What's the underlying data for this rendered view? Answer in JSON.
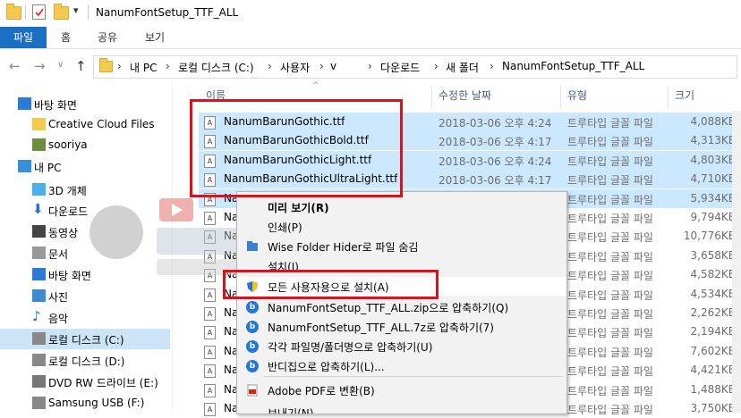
{
  "window": {
    "title": "NanumFontSetup_TTF_ALL"
  },
  "ribbon": {
    "tabs": [
      "파일",
      "홈",
      "공유",
      "보기"
    ]
  },
  "address": {
    "crumbs": [
      "내 PC",
      "로컬 디스크 (C:)",
      "사용자",
      "v",
      "다운로드",
      "새 폴더",
      "NanumFontSetup_TTF_ALL"
    ]
  },
  "nav": {
    "items": [
      {
        "label": "바탕 화면",
        "icon": "desktop-icon"
      },
      {
        "label": "Creative Cloud Files",
        "icon": "creative-cloud-folder-icon"
      },
      {
        "label": "sooriya",
        "icon": "user-icon"
      },
      {
        "label": "내 PC",
        "icon": "pc-icon"
      },
      {
        "label": "3D 개체",
        "icon": "3d-objects-icon"
      },
      {
        "label": "다운로드",
        "icon": "download-icon"
      },
      {
        "label": "동영상",
        "icon": "video-icon"
      },
      {
        "label": "문서",
        "icon": "document-icon"
      },
      {
        "label": "바탕 화면",
        "icon": "desktop-icon"
      },
      {
        "label": "사진",
        "icon": "picture-icon"
      },
      {
        "label": "음악",
        "icon": "music-icon"
      },
      {
        "label": "로컬 디스크 (C:)",
        "icon": "drive-icon"
      },
      {
        "label": "로컬 디스크 (D:)",
        "icon": "drive-icon"
      },
      {
        "label": "DVD RW 드라이브 (E:)",
        "icon": "dvd-icon"
      },
      {
        "label": "Samsung USB (F:)",
        "icon": "usb-icon"
      }
    ]
  },
  "columns": {
    "name": "이름",
    "date": "수정한 날짜",
    "type": "유형",
    "size": "크기"
  },
  "files": [
    {
      "name": "NanumBarunGothic.ttf",
      "date": "2018-03-06 오후 4:24",
      "type": "트루타입 글꼴 파일",
      "size": "4,088KB"
    },
    {
      "name": "NanumBarunGothicBold.ttf",
      "date": "2018-03-06 오후 4:17",
      "type": "트루타입 글꼴 파일",
      "size": "4,313KB"
    },
    {
      "name": "NanumBarunGothicLight.ttf",
      "date": "2018-03-06 오후 4:24",
      "type": "트루타입 글꼴 파일",
      "size": "4,803KB"
    },
    {
      "name": "NanumBarunGothicUltraLight.ttf",
      "date": "2018-03-06 오후 4:17",
      "type": "트루타입 글꼴 파일",
      "size": "4,710KB"
    },
    {
      "name": "Na",
      "date": "",
      "type": "트루타입 글꼴 파일",
      "size": "5,934KB"
    },
    {
      "name": "Na",
      "date": "",
      "type": "트루타입 글꼴 파일",
      "size": "9,794KB"
    },
    {
      "name": "Na",
      "date": "",
      "type": "트루타입 글꼴 파일",
      "size": "10,776KB"
    },
    {
      "name": "Na",
      "date": "",
      "type": "트루타입 글꼴 파일",
      "size": "3,658KB"
    },
    {
      "name": "Na",
      "date": "",
      "type": "트루타입 글꼴 파일",
      "size": "4,582KB"
    },
    {
      "name": "Na",
      "date": "",
      "type": "트루타입 글꼴 파일",
      "size": "4,534KB"
    },
    {
      "name": "Na",
      "date": "",
      "type": "트루타입 글꼴 파일",
      "size": "2,262KB"
    },
    {
      "name": "Na",
      "date": "",
      "type": "트루타입 글꼴 파일",
      "size": "2,194KB"
    },
    {
      "name": "Na",
      "date": "",
      "type": "트루타입 글꼴 파일",
      "size": "7,602KB"
    },
    {
      "name": "Na",
      "date": "",
      "type": "트루타입 글꼴 파일",
      "size": "4,421KB"
    },
    {
      "name": "Na",
      "date": "",
      "type": "트루타입 글꼴 파일",
      "size": "1,488KB"
    },
    {
      "name": "Na",
      "date": "",
      "type": "트루타입 글꼴 파일",
      "size": "3,750KB"
    }
  ],
  "context_menu": {
    "items": [
      {
        "label": "미리 보기(R)",
        "bold": true,
        "icon": ""
      },
      {
        "label": "인쇄(P)",
        "icon": ""
      },
      {
        "label": "Wise Folder Hider로 파일 숨김",
        "icon": "wise-folder-hider-icon"
      },
      {
        "label": "설치(I)",
        "icon": ""
      },
      {
        "label": "모든 사용자용으로 설치(A)",
        "icon": "uac-shield-icon"
      },
      {
        "label": "NanumFontSetup_TTF_ALL.zip으로 압축하기(Q)",
        "icon": "bandizip-icon"
      },
      {
        "label": "NanumFontSetup_TTF_ALL.7z로 압축하기(7)",
        "icon": "bandizip-icon"
      },
      {
        "label": "각각 파일명/폴더명으로 압축하기(U)",
        "icon": "bandizip-icon"
      },
      {
        "label": "반디집으로 압축하기(L)...",
        "icon": "bandizip-icon"
      },
      {
        "label": "Adobe PDF로 변환(B)",
        "icon": "adobe-pdf-icon"
      },
      {
        "label": "보내기(N)",
        "icon": ""
      }
    ]
  },
  "colors": {
    "accent": "#1a6fc4",
    "selection": "#cce8ff",
    "highlight_box": "#e0101a"
  }
}
